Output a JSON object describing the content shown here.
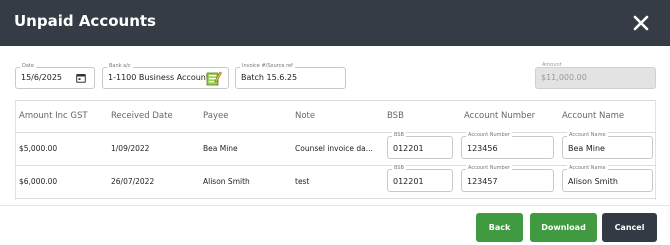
{
  "header": {
    "title": "Unpaid Accounts"
  },
  "form": {
    "date": {
      "label": "Date",
      "value": "15/6/2025"
    },
    "bank": {
      "label": "Bank a/c",
      "value": "1-1100 Business Account"
    },
    "invoice": {
      "label": "Invoice #/Source ref",
      "value": "Batch 15.6.25"
    },
    "amount": {
      "label": "Amount",
      "value": "$11,000.00"
    }
  },
  "table": {
    "headers": [
      "Amount Inc GST",
      "Received Date",
      "Payee",
      "Note",
      "BSB",
      "Account Number",
      "Account Name"
    ],
    "input_labels": {
      "bsb": "BSB",
      "account_number": "Account Number",
      "account_name": "Account Name"
    },
    "rows": [
      {
        "amount": "$5,000.00",
        "received_date": "1/09/2022",
        "payee": "Bea Mine",
        "note": "Counsel invoice da...",
        "bsb": "012201",
        "account_number": "123456",
        "account_name": "Bea Mine"
      },
      {
        "amount": "$6,000.00",
        "received_date": "26/07/2022",
        "payee": "Alison Smith",
        "note": "test",
        "bsb": "012201",
        "account_number": "123457",
        "account_name": "Alison Smith"
      }
    ]
  },
  "buttons": {
    "back": "Back",
    "download": "Download",
    "cancel": "Cancel"
  },
  "icons": {
    "close": "close-icon",
    "calendar": "calendar-icon",
    "bank": "bank-ledger-icon"
  },
  "colors": {
    "header_bg": "#353c46",
    "primary_green": "#3f9a40",
    "cancel_dark": "#333a44"
  }
}
